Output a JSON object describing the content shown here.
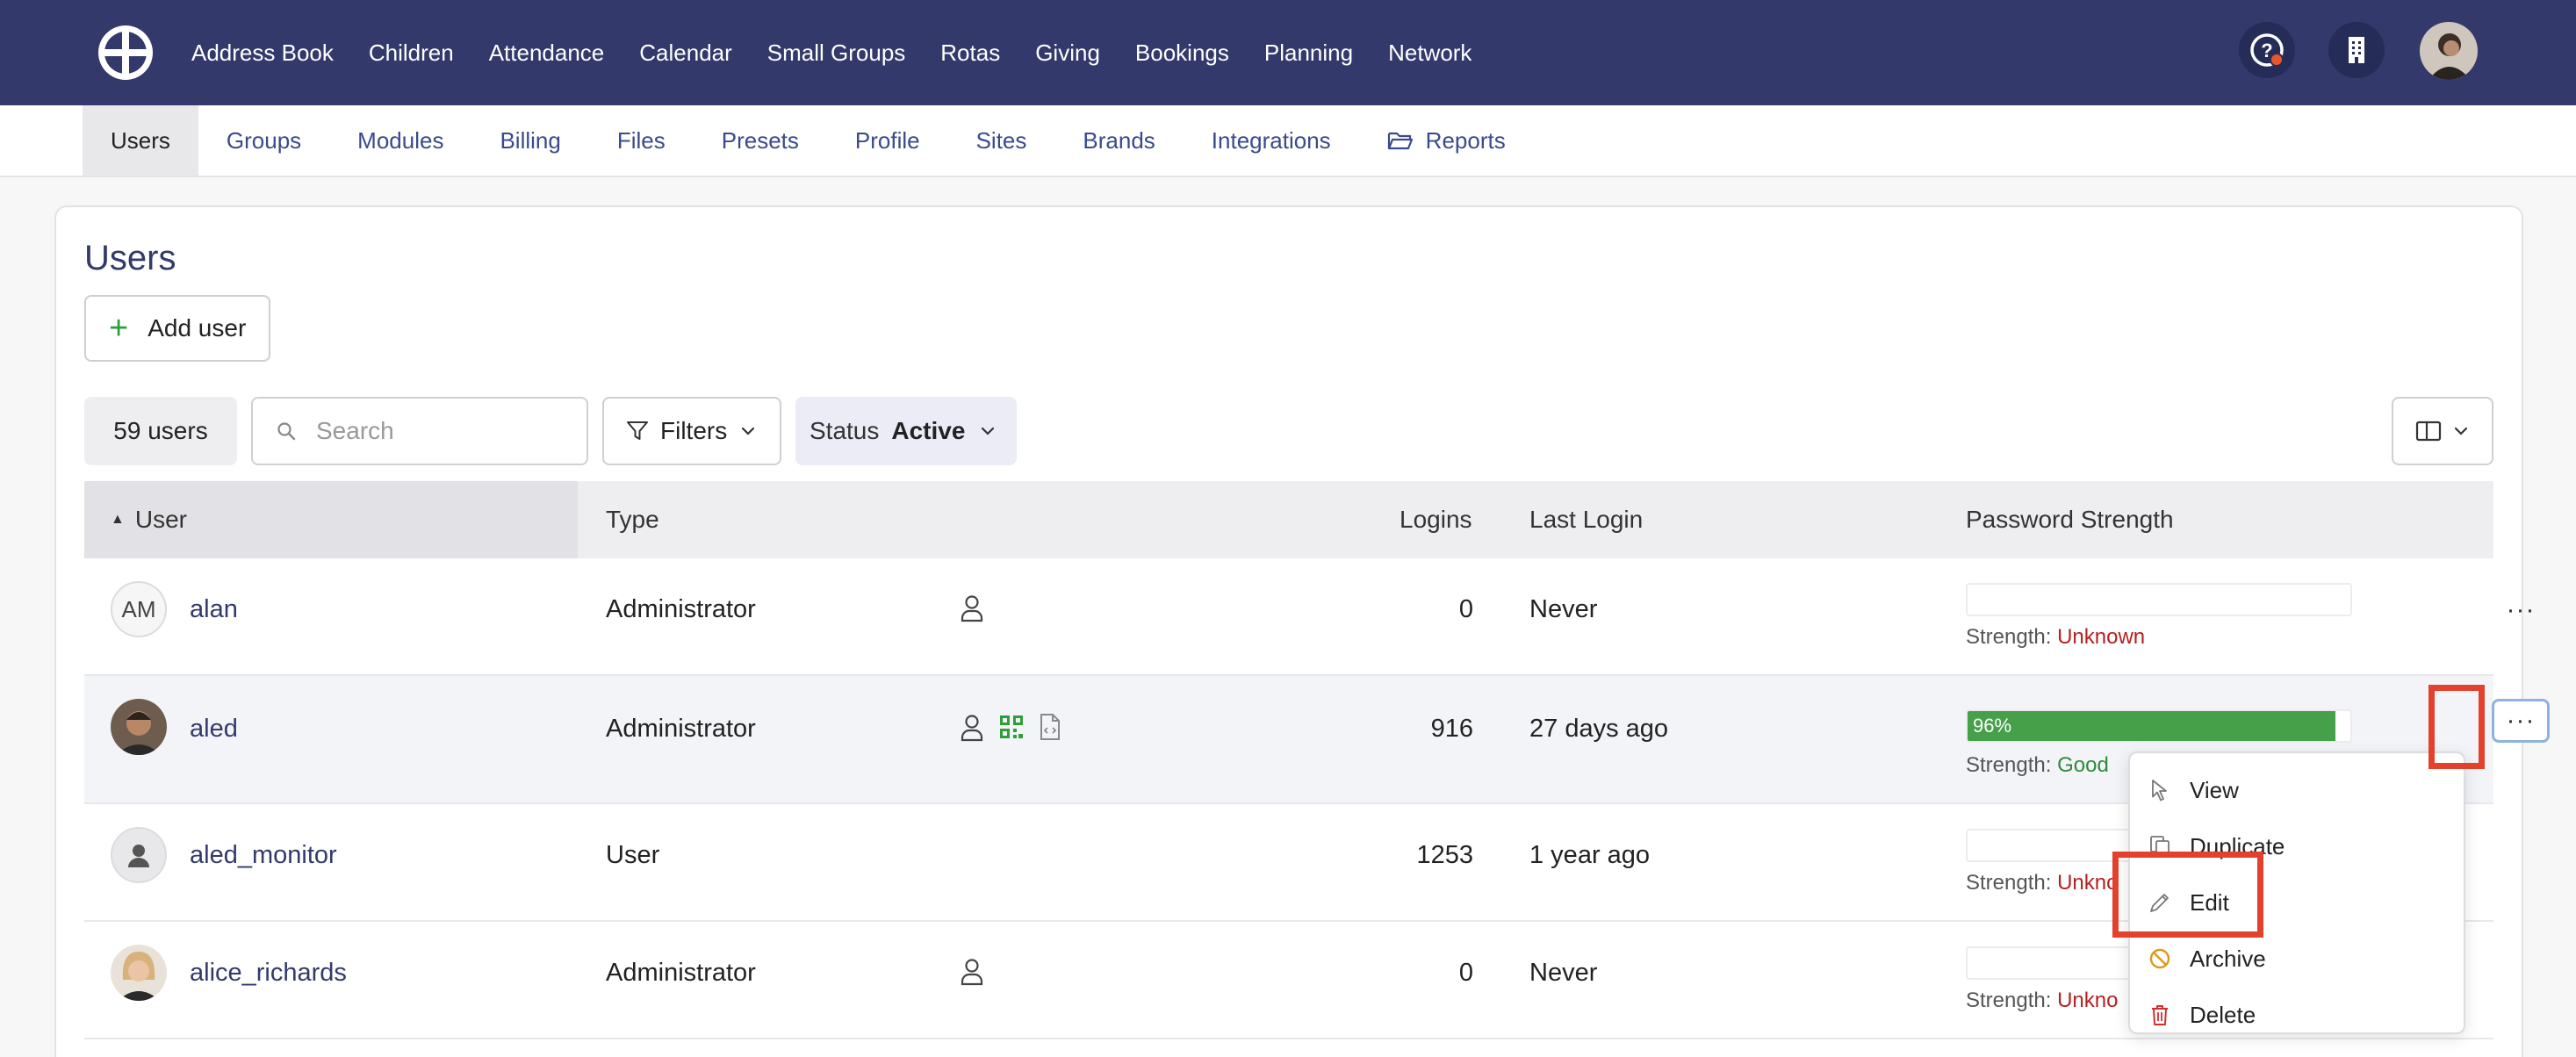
{
  "topnav": {
    "items": [
      "Address Book",
      "Children",
      "Attendance",
      "Calendar",
      "Small Groups",
      "Rotas",
      "Giving",
      "Bookings",
      "Planning",
      "Network"
    ],
    "icons": [
      "help-icon",
      "building-icon"
    ]
  },
  "subnav": {
    "items": [
      "Users",
      "Groups",
      "Modules",
      "Billing",
      "Files",
      "Presets",
      "Profile",
      "Sites",
      "Brands",
      "Integrations",
      "Reports"
    ],
    "active": "Users"
  },
  "page": {
    "title": "Users",
    "add_user_label": "Add user"
  },
  "toolbar": {
    "count": "59 users",
    "search_placeholder": "Search",
    "filters_label": "Filters",
    "status_key": "Status",
    "status_value": "Active"
  },
  "table": {
    "headers": {
      "user": "User",
      "type": "Type",
      "logins": "Logins",
      "last_login": "Last Login",
      "password_strength": "Password Strength"
    },
    "strength_prefix": "Strength:",
    "rows": [
      {
        "initials": "AM",
        "username": "alan",
        "type": "Administrator",
        "logins": "0",
        "last_login": "Never",
        "strength_pct": "",
        "strength": "Unknown"
      },
      {
        "initials": "",
        "username": "aled",
        "type": "Administrator",
        "logins": "916",
        "last_login": "27 days ago",
        "strength_pct": "96%",
        "strength_value": 0.96,
        "strength": "Good"
      },
      {
        "initials": "",
        "username": "aled_monitor",
        "type": "User",
        "logins": "1253",
        "last_login": "1 year ago",
        "strength_pct": "",
        "strength": "Unkno"
      },
      {
        "initials": "",
        "username": "alice_richards",
        "type": "Administrator",
        "logins": "0",
        "last_login": "Never",
        "strength_pct": "",
        "strength": "Unkno"
      }
    ]
  },
  "dropdown": {
    "items": [
      "View",
      "Duplicate",
      "Edit",
      "Archive",
      "Delete"
    ]
  },
  "colors": {
    "navbar": "#333a6b",
    "accent_green": "#45a049",
    "danger": "#b52020",
    "highlight_red": "#e3412e"
  }
}
